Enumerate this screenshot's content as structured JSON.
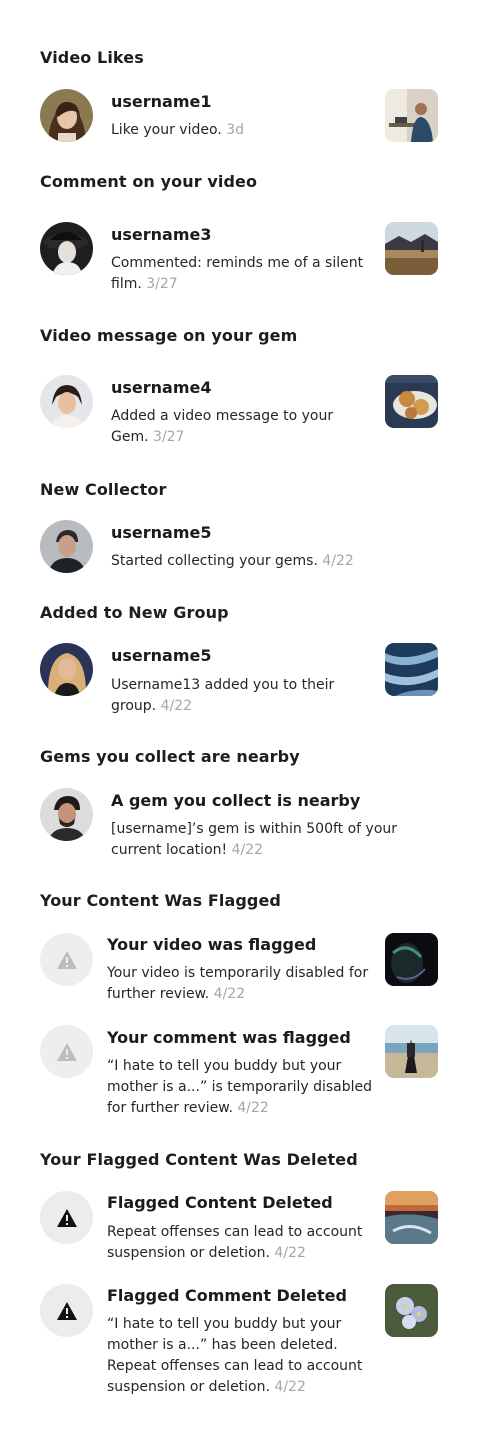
{
  "sections": [
    {
      "title": "Video Likes",
      "items": [
        {
          "name": "username1",
          "text": "Like your video.",
          "time": "3d"
        }
      ]
    },
    {
      "title": "Comment on your video",
      "items": [
        {
          "name": "username3",
          "text": "Commented: reminds me of a silent film.",
          "time": "3/27"
        }
      ]
    },
    {
      "title": "Video message on your gem",
      "items": [
        {
          "name": "username4",
          "text": "Added a video message to your Gem.",
          "time": "3/27"
        }
      ]
    },
    {
      "title": "New Collector",
      "items": [
        {
          "name": "username5",
          "text": "Started collecting your gems.",
          "time": "4/22"
        }
      ]
    },
    {
      "title": "Added to New Group",
      "items": [
        {
          "name": "username5",
          "text": "Username13 added you to their group.",
          "time": "4/22"
        }
      ]
    },
    {
      "title": "Gems you collect are nearby",
      "items": [
        {
          "name": "A gem you collect is nearby",
          "text": "[username]’s gem is within 500ft of your current location!",
          "time": "4/22"
        }
      ]
    },
    {
      "title": "Your Content Was Flagged",
      "items": [
        {
          "name": "Your video was flagged",
          "text": "Your video is temporarily disabled for further review.",
          "time": "4/22"
        },
        {
          "name": "Your comment was flagged",
          "text": "“I hate to tell you buddy but your mother is a...” is temporarily disabled for further review.",
          "time": "4/22"
        }
      ]
    },
    {
      "title": "Your Flagged Content Was Deleted",
      "items": [
        {
          "name": "Flagged Content Deleted",
          "text": "Repeat offenses can lead to account suspension or deletion.",
          "time": "4/22"
        },
        {
          "name": "Flagged Comment Deleted",
          "text": "“I hate to tell you buddy but your mother is a...” has been deleted. Repeat offenses can lead to account suspension or deletion.",
          "time": "4/22"
        }
      ]
    }
  ],
  "icons": {
    "soft_warning": "warning-triangle-icon",
    "hard_warning": "warning-triangle-icon"
  },
  "colors": {
    "timestamp": "#a6a6a6",
    "warning_soft": "#bdbdbd",
    "warning_hard": "#111111",
    "icon_bg": "#eeeeee"
  }
}
